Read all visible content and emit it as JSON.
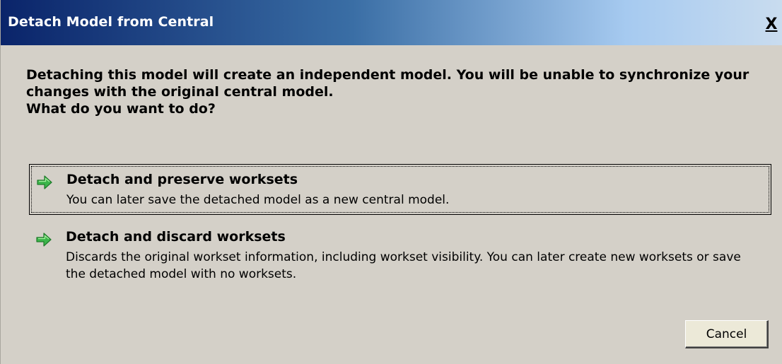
{
  "window": {
    "title": "Detach Model from Central",
    "close_label": "X"
  },
  "prompt": {
    "line1": "Detaching this model will create an independent model. You will be unable to synchronize your",
    "line2": "changes with the original central model.",
    "line3": "What do you want to do?"
  },
  "options": [
    {
      "title": "Detach and preserve worksets",
      "description": "You can later save the detached model as a new central model.",
      "icon": "green-arrow-icon",
      "focused": true
    },
    {
      "title": "Detach and discard worksets",
      "description": "Discards the original workset information, including workset visibility. You can later create new worksets or save the detached model with no worksets.",
      "icon": "green-arrow-icon",
      "focused": false
    }
  ],
  "buttons": {
    "cancel_label": "Cancel"
  },
  "colors": {
    "dialog_background": "#d4d0c8",
    "titlebar_start": "#0a246a",
    "titlebar_end": "#c9dcef",
    "arrow_green": "#3bb54a"
  }
}
